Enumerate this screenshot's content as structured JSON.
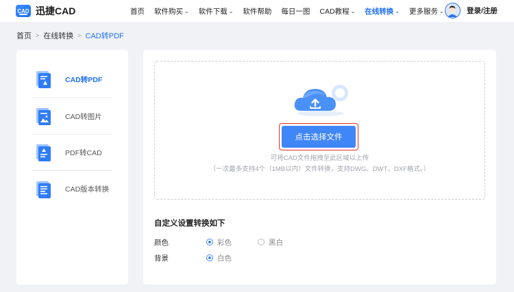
{
  "header": {
    "logo_mark": "CAD",
    "logo_text": "迅捷CAD",
    "nav": [
      {
        "label": "首页",
        "chevron": false,
        "active": false
      },
      {
        "label": "软件购买",
        "chevron": true,
        "active": false
      },
      {
        "label": "软件下载",
        "chevron": true,
        "active": false
      },
      {
        "label": "软件帮助",
        "chevron": false,
        "active": false
      },
      {
        "label": "每日一图",
        "chevron": false,
        "active": false
      },
      {
        "label": "CAD教程",
        "chevron": true,
        "active": false
      },
      {
        "label": "在线转换",
        "chevron": true,
        "active": true
      },
      {
        "label": "更多服务",
        "chevron": true,
        "active": false
      }
    ],
    "login": "登录/注册"
  },
  "breadcrumb": {
    "items": [
      "首页",
      "在线转换",
      "CAD转PDF"
    ]
  },
  "sidebar": {
    "items": [
      {
        "label": "CAD转PDF",
        "active": true,
        "icon": "cad-to-pdf-icon"
      },
      {
        "label": "CAD转图片",
        "active": false,
        "icon": "cad-to-image-icon"
      },
      {
        "label": "PDF转CAD",
        "active": false,
        "icon": "pdf-to-cad-icon"
      },
      {
        "label": "CAD版本转换",
        "active": false,
        "icon": "cad-version-icon"
      }
    ]
  },
  "upload": {
    "button": "点击选择文件",
    "hint1": "可将CAD文件拖拽至此区域以上传",
    "hint2": "（一次最多支持4个（1MB以内）文件转换，支持DWG、DWT、DXF格式。）"
  },
  "settings": {
    "title": "自定义设置转换如下",
    "color": {
      "label": "颜色",
      "options": [
        "彩色",
        "黑白"
      ],
      "selected": "彩色"
    },
    "background": {
      "label": "背景",
      "options": [
        "白色"
      ],
      "selected": "白色"
    }
  },
  "colors": {
    "accent": "#1f6ff2",
    "button": "#3f86f7",
    "highlight_border": "#e0302a"
  }
}
